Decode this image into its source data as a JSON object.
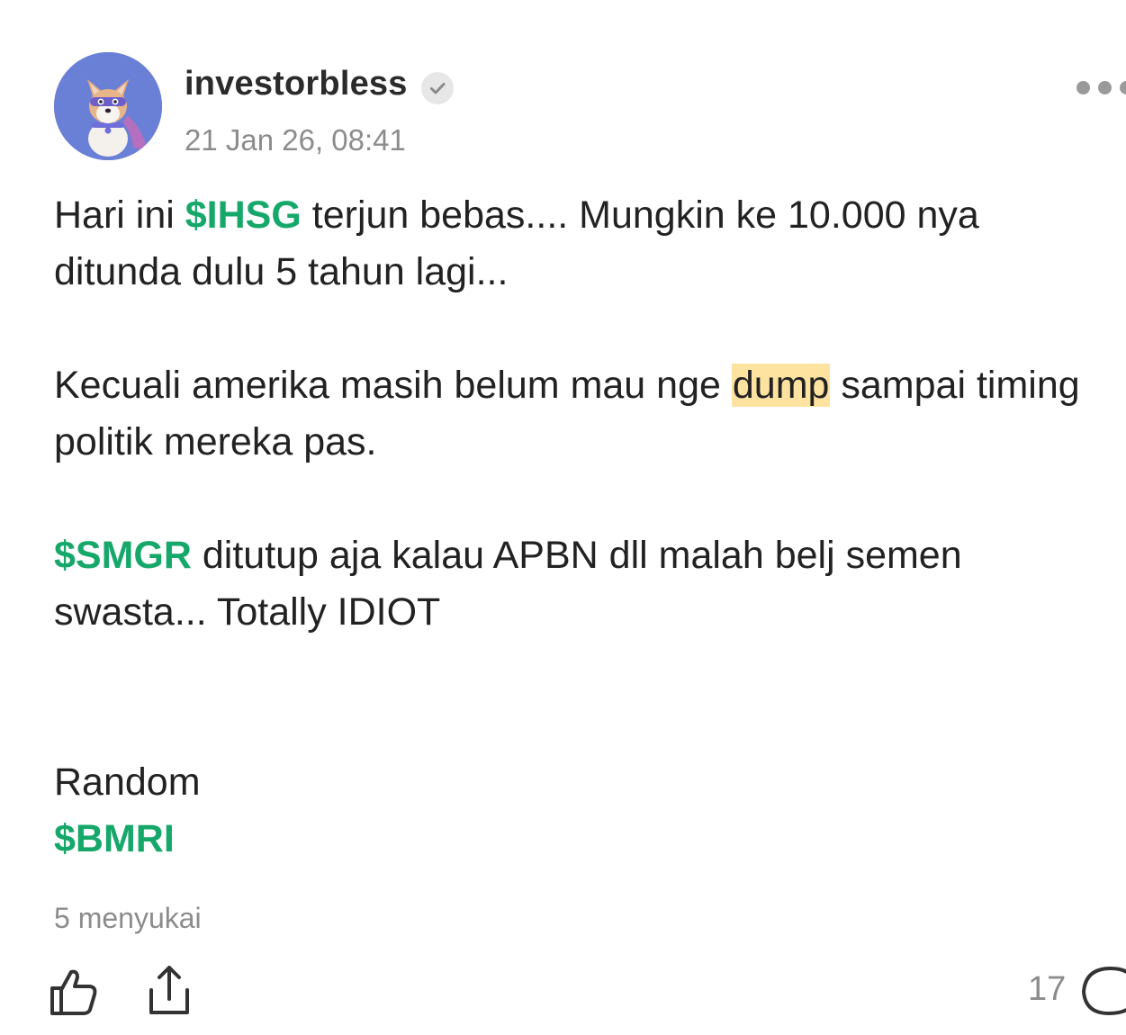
{
  "post": {
    "author": {
      "username": "investorbless",
      "verified": true,
      "avatar": "dog-avatar-icon"
    },
    "timestamp": "21 Jan 26, 08:41",
    "paragraphs": {
      "p1": {
        "t1": "Hari ini ",
        "ticker": "$IHSG",
        "t2": " terjun bebas.... Mungkin ke 10.000 nya ditunda dulu 5 tahun lagi..."
      },
      "p2": {
        "t1": "Kecuali amerika masih belum mau nge ",
        "highlight": "dump",
        "t2": " sampai timing politik mereka pas."
      },
      "p3": {
        "ticker": "$SMGR",
        "t1": " ditutup aja kalau APBN dll malah belj semen swasta... Totally IDIOT"
      },
      "p4": {
        "t1": "Random",
        "ticker": "$BMRI"
      }
    },
    "likes_text": "5 menyukai",
    "comment_count": "17"
  },
  "colors": {
    "ticker": "#16a86a",
    "highlight": "#fde2a0",
    "muted_text": "#8c8c8c",
    "body_text": "#222222",
    "avatar_bg": "#6a7fd6"
  },
  "icons": {
    "like": "thumbs-up-icon",
    "share": "share-icon",
    "comment": "comment-bubble-icon",
    "more": "more-dots-icon",
    "verified": "check-badge-icon"
  }
}
